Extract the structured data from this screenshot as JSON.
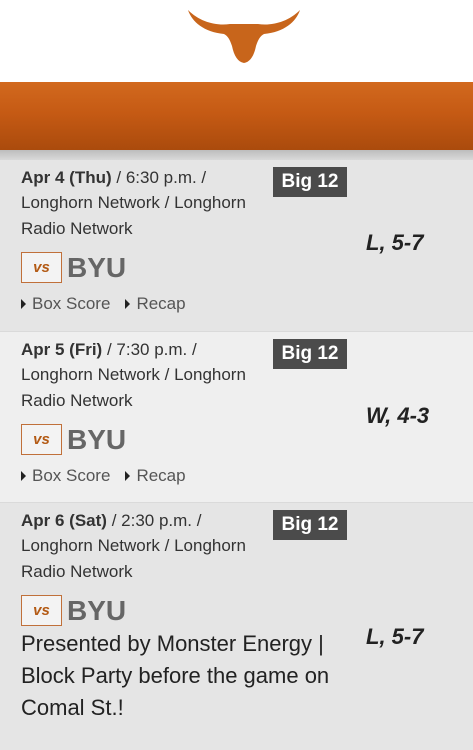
{
  "header": {
    "logo_icon": "longhorn-logo-icon",
    "accent_color": "#c8651b"
  },
  "games": [
    {
      "date": "Apr 4 (Thu)",
      "details": " / 6:30 p.m. / Longhorn Network / Longhorn Radio Network",
      "conference": "Big 12",
      "vs_label": "vs",
      "opponent": "BYU",
      "result": "L, 5-7",
      "links": [
        "Box Score",
        "Recap"
      ]
    },
    {
      "date": "Apr 5 (Fri)",
      "details": " / 7:30 p.m. / Longhorn Network / Longhorn Radio Network",
      "conference": "Big 12",
      "vs_label": "vs",
      "opponent": "BYU",
      "result": "W, 4-3",
      "links": [
        "Box Score",
        "Recap"
      ]
    },
    {
      "date": "Apr 6 (Sat)",
      "details": " / 2:30 p.m. / Longhorn Network / Longhorn Radio Network",
      "conference": "Big 12",
      "vs_label": "vs",
      "opponent": "BYU",
      "result": "L, 5-7",
      "promo": "Presented by Monster Energy | Block Party before the game on Comal St.!"
    }
  ]
}
